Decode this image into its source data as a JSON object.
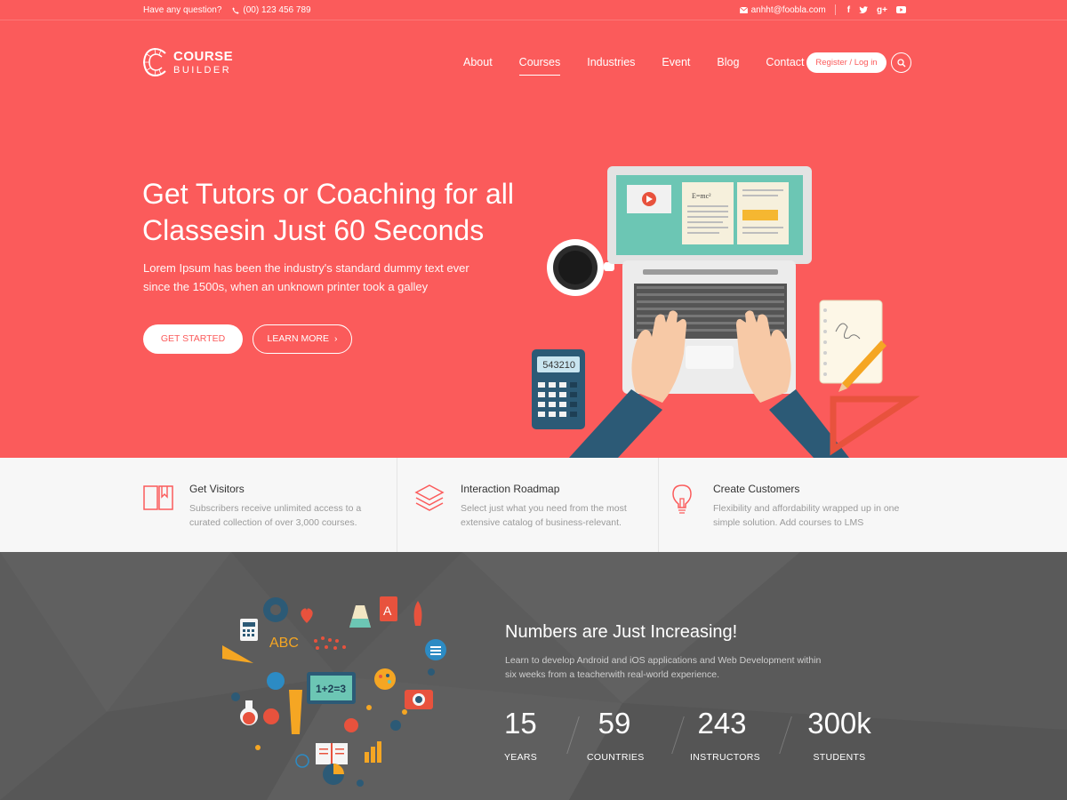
{
  "topbar": {
    "question": "Have any question?",
    "phone": "(00) 123 456 789",
    "email": "anhht@foobla.com",
    "social": [
      "f",
      "t",
      "g+",
      "yt"
    ]
  },
  "header": {
    "logo_line1": "COURSE",
    "logo_line2": "BUILDER",
    "nav": [
      "About",
      "Courses",
      "Industries",
      "Event",
      "Blog",
      "Contact"
    ],
    "active_nav": "Courses",
    "register_label": "Register / Log in"
  },
  "hero": {
    "title_line1": "Get Tutors or Coaching for all",
    "title_line2": "Classesin Just 60 Seconds",
    "subtitle": "Lorem Ipsum has been the industry's standard dummy text ever since the 1500s, when an unknown printer took a galley",
    "start_label": "GET STARTED",
    "more_label": "LEARN MORE",
    "calculator_display": "543210",
    "formula": "E=mc²"
  },
  "features": [
    {
      "title": "Get Visitors",
      "desc": "Subscribers receive unlimited access to a curated collection of over 3,000 courses.",
      "icon": "book-icon"
    },
    {
      "title": "Interaction Roadmap",
      "desc": "Select just what you need from the most extensive catalog of business-relevant.",
      "icon": "layers-icon"
    },
    {
      "title": "Create Customers",
      "desc": "Flexibility and affordability wrapped up in one simple solution. Add courses to LMS",
      "icon": "lightbulb-icon"
    }
  ],
  "stats": {
    "title": "Numbers are Just Increasing!",
    "desc": "Learn to develop Android and iOS applications and Web Development within six weeks from a teacherwith real-world experience.",
    "items": [
      {
        "num": "15",
        "label": "YEARS"
      },
      {
        "num": "59",
        "label": "COUNTRIES"
      },
      {
        "num": "243",
        "label": "INSTRUCTORS"
      },
      {
        "num": "300k",
        "label": "STUDENTS"
      }
    ],
    "heart_text_abc": "ABC",
    "heart_text_math": "1+2=3",
    "heart_text_a": "A"
  },
  "colors": {
    "brand": "#fb5b5b",
    "dark": "#5c5c5c",
    "feature_bg": "#f7f7f7"
  }
}
